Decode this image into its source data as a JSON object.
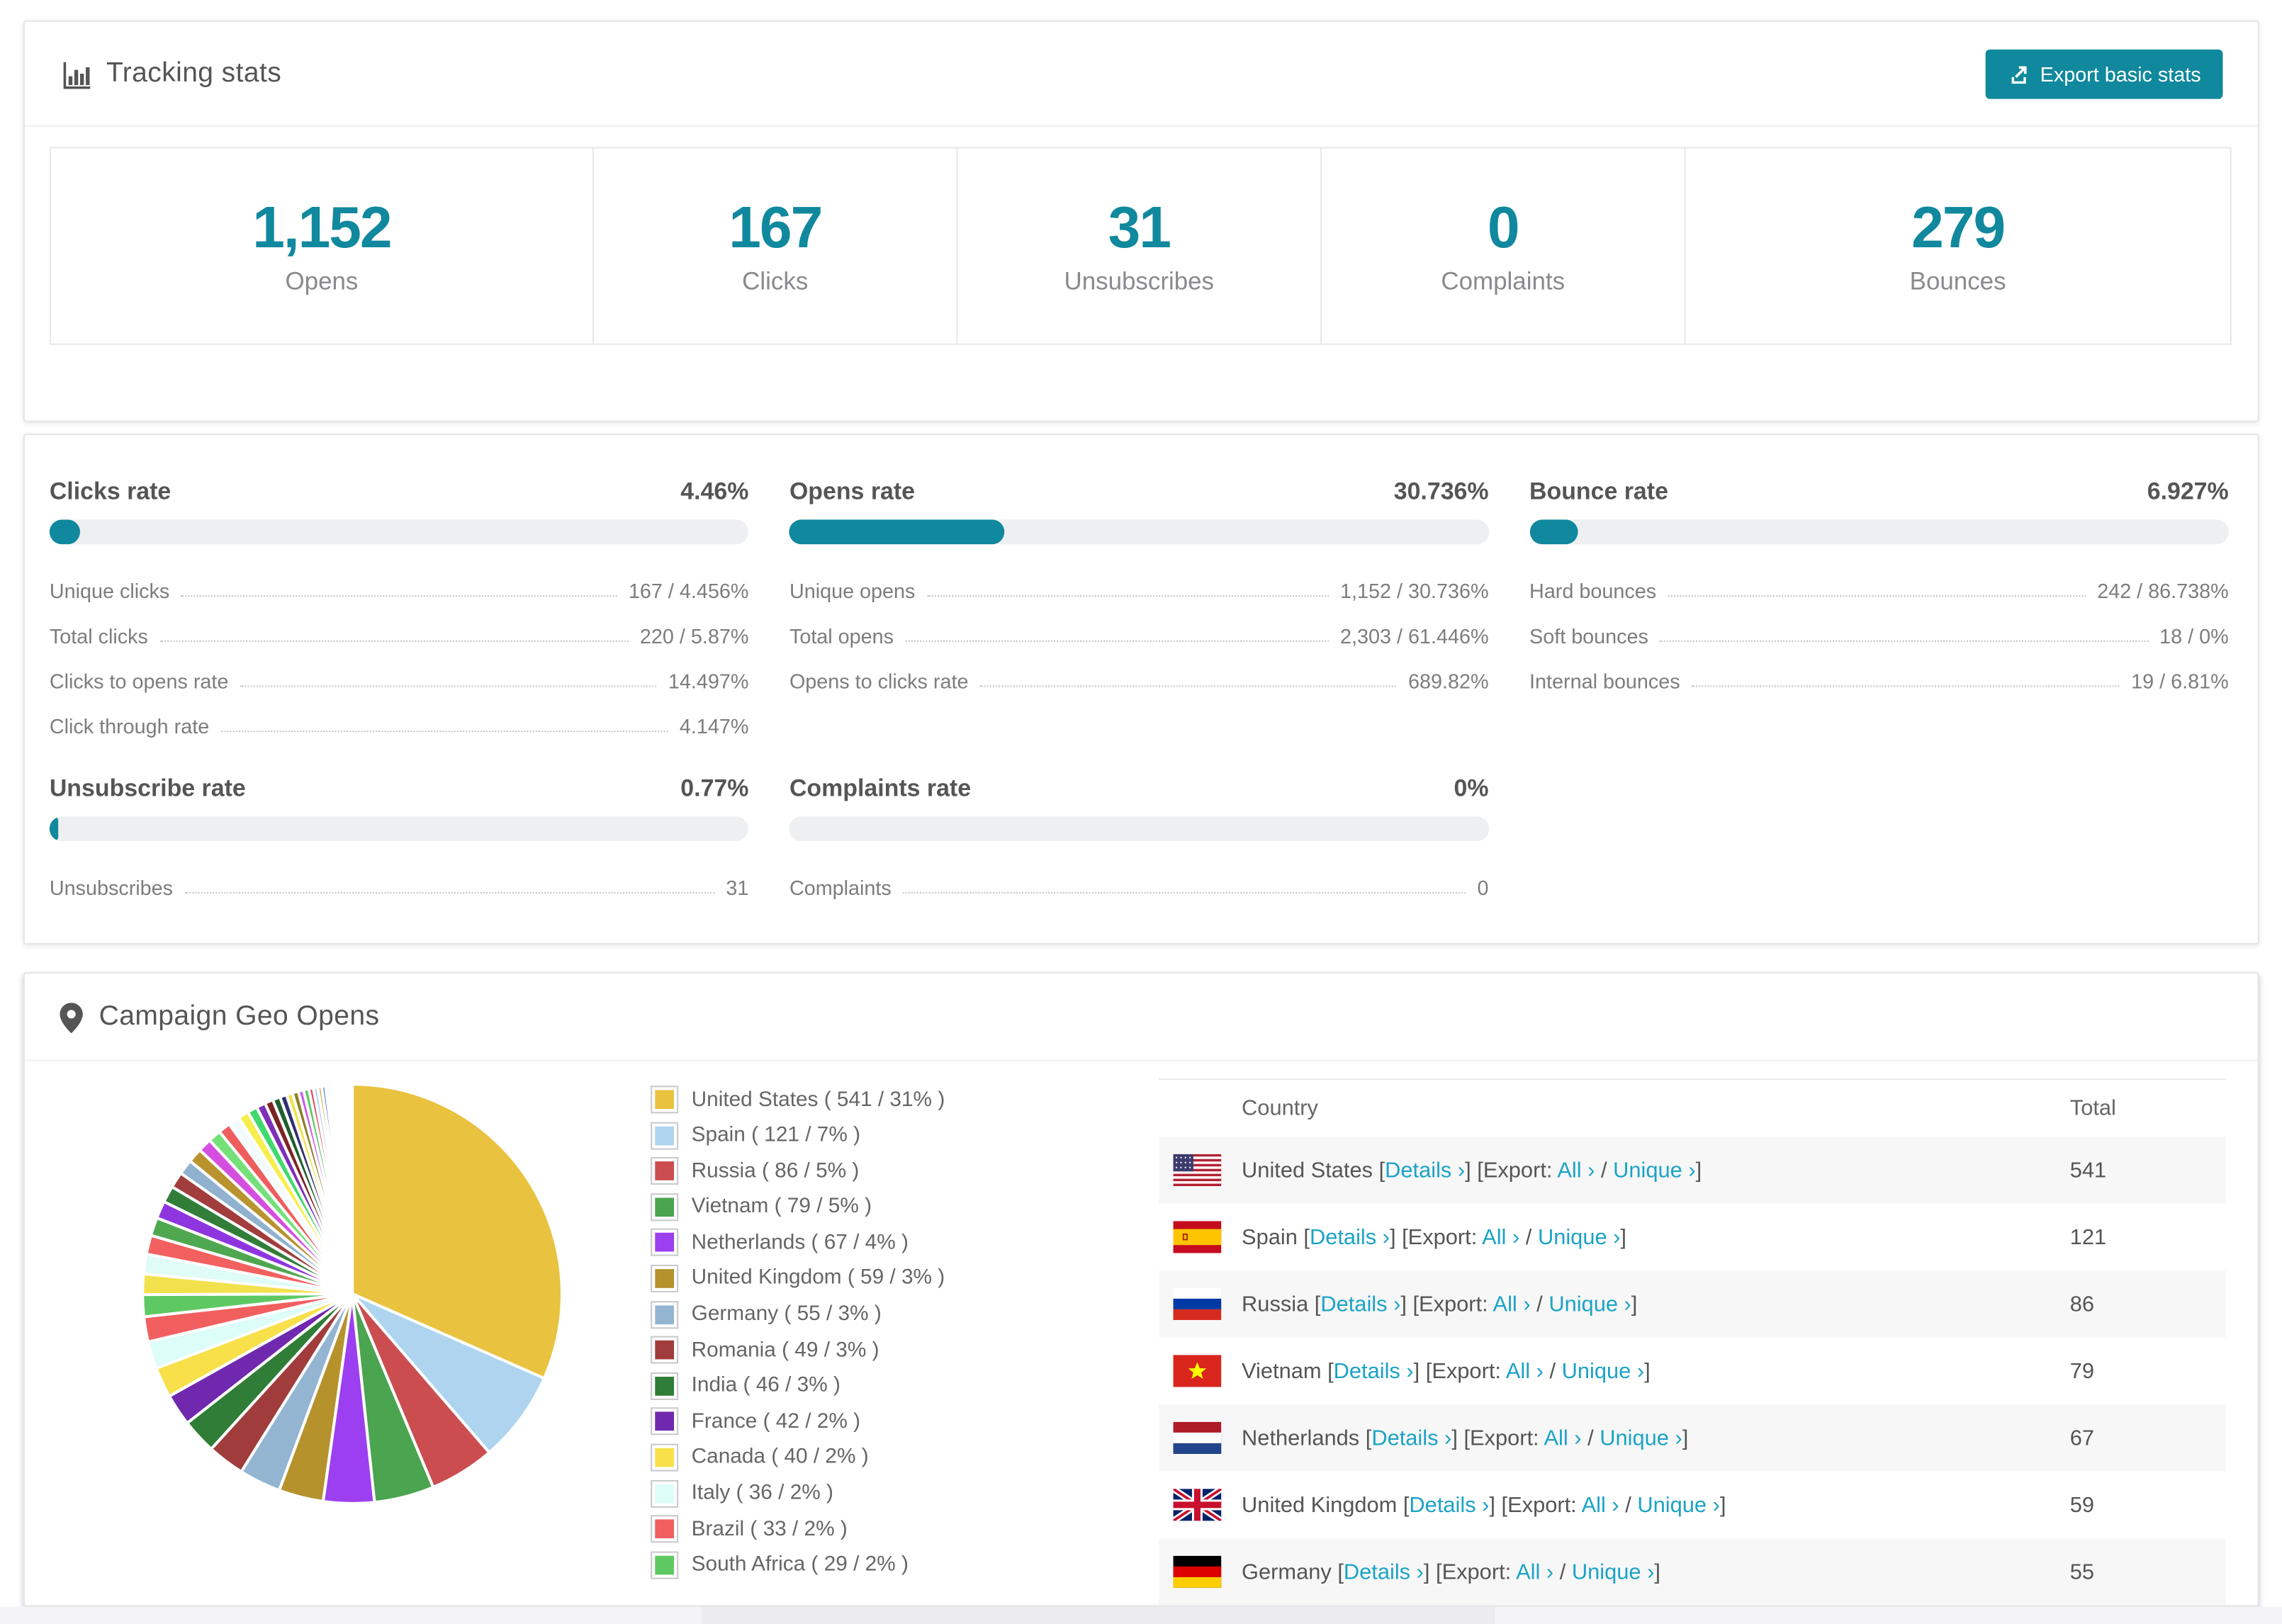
{
  "theme": {
    "teal": "#10889d",
    "link": "#1ba3c5",
    "border": "#e5e5e8",
    "stripe": "#f7f7f8",
    "track": "#edeff1"
  },
  "tracking_stats": {
    "title": "Tracking stats",
    "export_label": "Export basic stats",
    "boxes": [
      {
        "id": "opens",
        "value": "1,152",
        "label": "Opens"
      },
      {
        "id": "clicks",
        "value": "167",
        "label": "Clicks"
      },
      {
        "id": "unsubscribes",
        "value": "31",
        "label": "Unsubscribes"
      },
      {
        "id": "complaints",
        "value": "0",
        "label": "Complaints"
      },
      {
        "id": "bounces",
        "value": "279",
        "label": "Bounces"
      }
    ]
  },
  "rates": [
    {
      "id": "clicks-rate",
      "title": "Clicks rate",
      "value": "4.46%",
      "percent": 4.46,
      "rows": [
        [
          "Unique clicks",
          "167 / 4.456%"
        ],
        [
          "Total clicks",
          "220 / 5.87%"
        ],
        [
          "Clicks to opens rate",
          "14.497%"
        ],
        [
          "Click through rate",
          "4.147%"
        ]
      ]
    },
    {
      "id": "opens-rate",
      "title": "Opens rate",
      "value": "30.736%",
      "percent": 30.736,
      "rows": [
        [
          "Unique opens",
          "1,152 / 30.736%"
        ],
        [
          "Total opens",
          "2,303 / 61.446%"
        ],
        [
          "Opens to clicks rate",
          "689.82%"
        ]
      ]
    },
    {
      "id": "bounce-rate",
      "title": "Bounce rate",
      "value": "6.927%",
      "percent": 6.927,
      "rows": [
        [
          "Hard bounces",
          "242 / 86.738%"
        ],
        [
          "Soft bounces",
          "18 / 0%"
        ],
        [
          "Internal bounces",
          "19 / 6.81%"
        ]
      ]
    },
    {
      "id": "unsubscribe-rate",
      "title": "Unsubscribe rate",
      "value": "0.77%",
      "percent": 0.77,
      "rows": [
        [
          "Unsubscribes",
          "31"
        ]
      ]
    },
    {
      "id": "complaints-rate",
      "title": "Complaints rate",
      "value": "0%",
      "percent": 0,
      "rows": [
        [
          "Complaints",
          "0"
        ]
      ]
    }
  ],
  "geo": {
    "title": "Campaign Geo Opens",
    "table": {
      "col_country": "Country",
      "col_total": "Total",
      "links": {
        "details": "Details",
        "export": "Export:",
        "all": "All",
        "unique": "Unique",
        "chevron": "›"
      },
      "rows": [
        {
          "flag": "us",
          "country": "United States",
          "total": "541"
        },
        {
          "flag": "es",
          "country": "Spain",
          "total": "121"
        },
        {
          "flag": "ru",
          "country": "Russia",
          "total": "86"
        },
        {
          "flag": "vn",
          "country": "Vietnam",
          "total": "79"
        },
        {
          "flag": "nl",
          "country": "Netherlands",
          "total": "67"
        },
        {
          "flag": "gb",
          "country": "United Kingdom",
          "total": "59"
        },
        {
          "flag": "de",
          "country": "Germany",
          "total": "55"
        }
      ]
    }
  },
  "chart_data": {
    "type": "pie",
    "title": "Campaign Geo Opens",
    "legend_position": "right",
    "start_angle_deg": -90,
    "direction": "clockwise",
    "slices": [
      {
        "label": "United States",
        "value": 541,
        "pct": 31,
        "color": "#e9c23f"
      },
      {
        "label": "Spain",
        "value": 121,
        "pct": 7,
        "color": "#aed4f0"
      },
      {
        "label": "Russia",
        "value": 86,
        "pct": 5,
        "color": "#cb4d50"
      },
      {
        "label": "Vietnam",
        "value": 79,
        "pct": 5,
        "color": "#4ba44f"
      },
      {
        "label": "Netherlands",
        "value": 67,
        "pct": 4,
        "color": "#9c3ff0"
      },
      {
        "label": "United Kingdom",
        "value": 59,
        "pct": 3,
        "color": "#b6922d"
      },
      {
        "label": "Germany",
        "value": 55,
        "pct": 3,
        "color": "#93b5d2"
      },
      {
        "label": "Romania",
        "value": 49,
        "pct": 3,
        "color": "#a03c3c"
      },
      {
        "label": "India",
        "value": 46,
        "pct": 3,
        "color": "#2f7d36"
      },
      {
        "label": "France",
        "value": 42,
        "pct": 2,
        "color": "#7029ae"
      },
      {
        "label": "Canada",
        "value": 40,
        "pct": 2,
        "color": "#f8e04b"
      },
      {
        "label": "Italy",
        "value": 36,
        "pct": 2,
        "color": "#dcfdf8"
      },
      {
        "label": "Brazil",
        "value": 33,
        "pct": 2,
        "color": "#f15f5f"
      },
      {
        "label": "South Africa",
        "value": 29,
        "pct": 2,
        "color": "#5ec962"
      }
    ],
    "others": {
      "note": "remaining small-country slices drawn clockwise after the named slices",
      "values": [
        27,
        26,
        25,
        24,
        23,
        22,
        21,
        20,
        19,
        18,
        17,
        16,
        15,
        14,
        13,
        12,
        11,
        10,
        9,
        8,
        8,
        7,
        7,
        6,
        6,
        5,
        5,
        4,
        4,
        3,
        3,
        3,
        2,
        2,
        2,
        2,
        2,
        1,
        1,
        1,
        1,
        1,
        1,
        1,
        1
      ],
      "palette": [
        "#f2e14d",
        "#dffcf7",
        "#f2615f",
        "#4fa850",
        "#8e35e0",
        "#327e38",
        "#a23d3d",
        "#90b2cf",
        "#b8932e",
        "#d44fe0",
        "#73e07a",
        "#ee5e5e",
        "#f4fbfd",
        "#f6ee4e",
        "#41d96d",
        "#7e2fb8",
        "#7c2424",
        "#1f5f2d",
        "#303070",
        "#efe24c",
        "#8f7d22",
        "#cf58e8",
        "#5bc75f",
        "#e0485c",
        "#b9d8f1",
        "#caa52b",
        "#4479d1",
        "#e883e2",
        "#4bb8a2",
        "#d64f4f"
      ]
    }
  }
}
